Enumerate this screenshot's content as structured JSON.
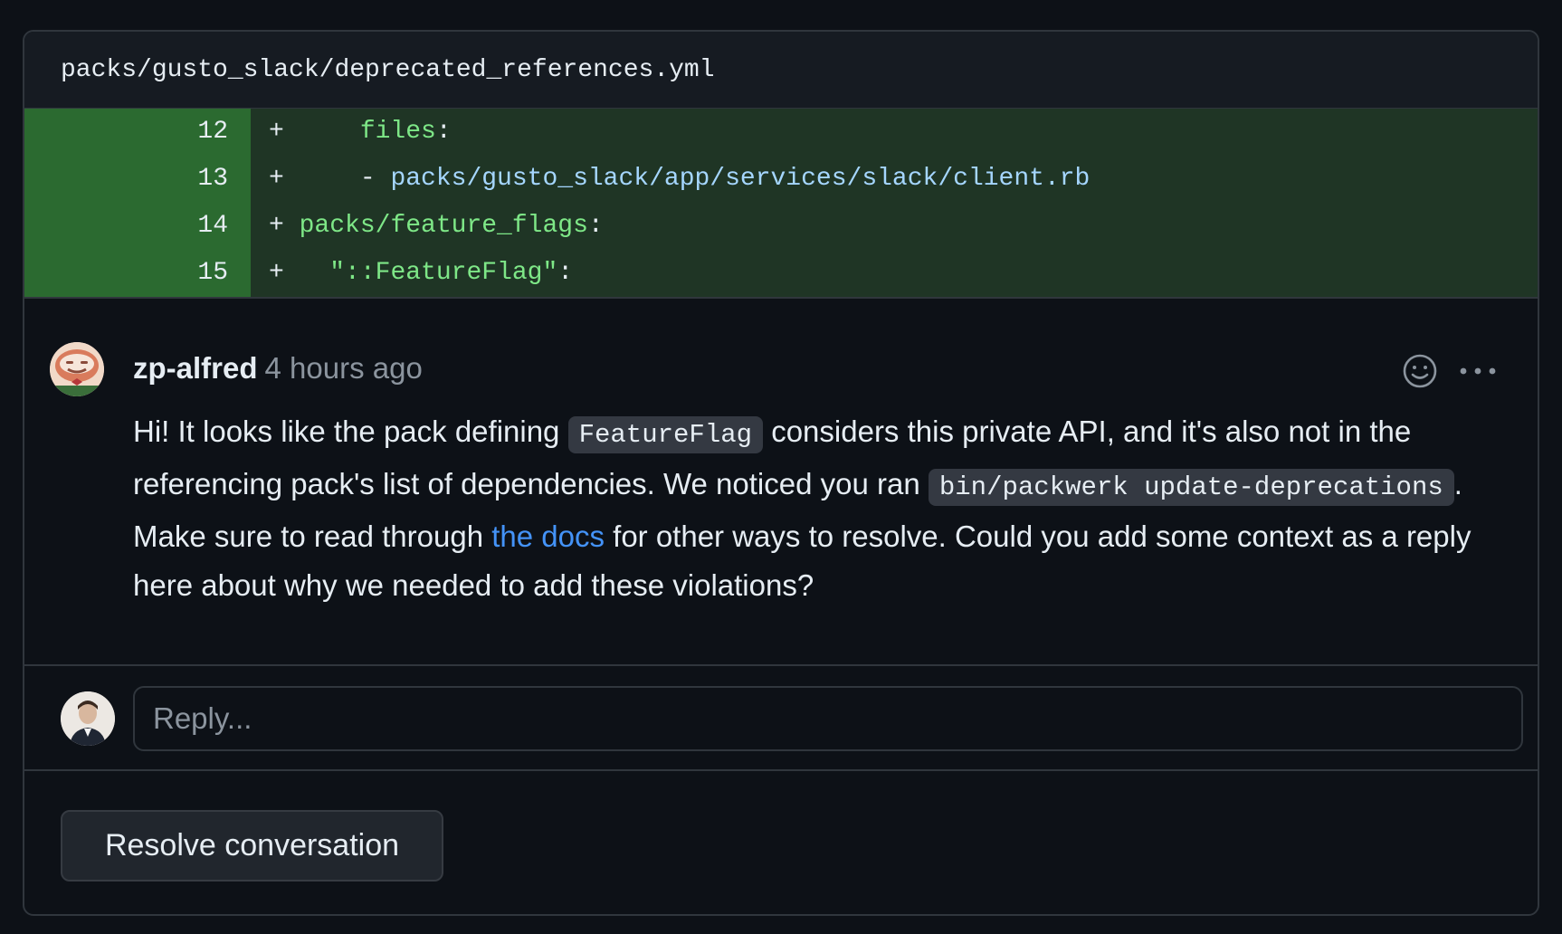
{
  "file": {
    "path": "packs/gusto_slack/deprecated_references.yml"
  },
  "diff": {
    "lines": [
      {
        "num": "12",
        "marker": "+",
        "indent": "     ",
        "parts": [
          {
            "t": "key",
            "v": "files"
          },
          {
            "t": "punct",
            "v": ":"
          }
        ]
      },
      {
        "num": "13",
        "marker": "+",
        "indent": "     ",
        "parts": [
          {
            "t": "punct",
            "v": "- "
          },
          {
            "t": "str",
            "v": "packs/gusto_slack/app/services/slack/client.rb"
          }
        ]
      },
      {
        "num": "14",
        "marker": "+",
        "indent": " ",
        "parts": [
          {
            "t": "key",
            "v": "packs/feature_flags"
          },
          {
            "t": "punct",
            "v": ":"
          }
        ]
      },
      {
        "num": "15",
        "marker": "+",
        "indent": "   ",
        "parts": [
          {
            "t": "key",
            "v": "\"::FeatureFlag\""
          },
          {
            "t": "punct",
            "v": ":"
          }
        ]
      }
    ]
  },
  "comment": {
    "author": "zp-alfred",
    "time": "4 hours ago",
    "body_1": "Hi! It looks like the pack defining ",
    "code_1": "FeatureFlag",
    "body_2": " considers this private API, and it's also not in the referencing pack's list of dependencies. We noticed you ran ",
    "code_2": "bin/packwerk update-deprecations",
    "body_3": ". Make sure to read through ",
    "link": "the docs",
    "body_4": " for other ways to resolve. Could you add some context as a reply here about why we needed to add these violations?"
  },
  "reply": {
    "placeholder": "Reply..."
  },
  "actions": {
    "resolve_label": "Resolve conversation"
  },
  "colors": {
    "background": "#0d1117",
    "diff_added_num": "#2b6a30",
    "diff_added_code": "#1f3525",
    "link": "#4493f8"
  }
}
